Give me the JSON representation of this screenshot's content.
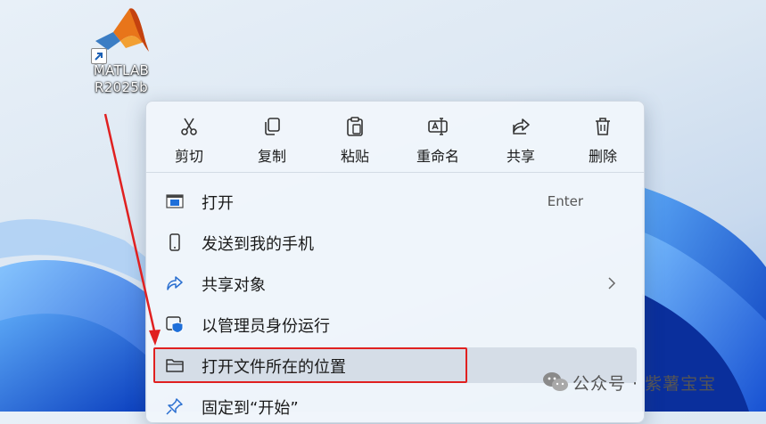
{
  "desktop": {
    "icon": {
      "name": "matlab-icon",
      "label_line1": "MATLAB",
      "label_line2": "R2025b"
    }
  },
  "context_menu": {
    "actions": [
      {
        "label": "剪切",
        "icon": "scissors-icon"
      },
      {
        "label": "复制",
        "icon": "copy-icon"
      },
      {
        "label": "粘贴",
        "icon": "paste-icon"
      },
      {
        "label": "重命名",
        "icon": "rename-icon"
      },
      {
        "label": "共享",
        "icon": "share-icon"
      },
      {
        "label": "删除",
        "icon": "trash-icon"
      }
    ],
    "items": [
      {
        "label": "打开",
        "shortcut": "Enter",
        "icon": "open-window-icon"
      },
      {
        "label": "发送到我的手机",
        "icon": "phone-icon"
      },
      {
        "label": "共享对象",
        "icon": "share-icon",
        "has_submenu": true
      },
      {
        "label": "以管理员身份运行",
        "icon": "admin-shield-icon"
      },
      {
        "label": "打开文件所在的位置",
        "icon": "folder-icon",
        "highlighted": true
      },
      {
        "label": "固定到“开始”",
        "icon": "pin-icon"
      }
    ]
  },
  "annotation": {
    "color": "#e02020"
  },
  "watermark": {
    "text": "公众号 · 紫薯宝宝",
    "icon": "wechat-icon"
  },
  "colors": {
    "accent": "#0067c0",
    "highlight": "#e02020"
  }
}
